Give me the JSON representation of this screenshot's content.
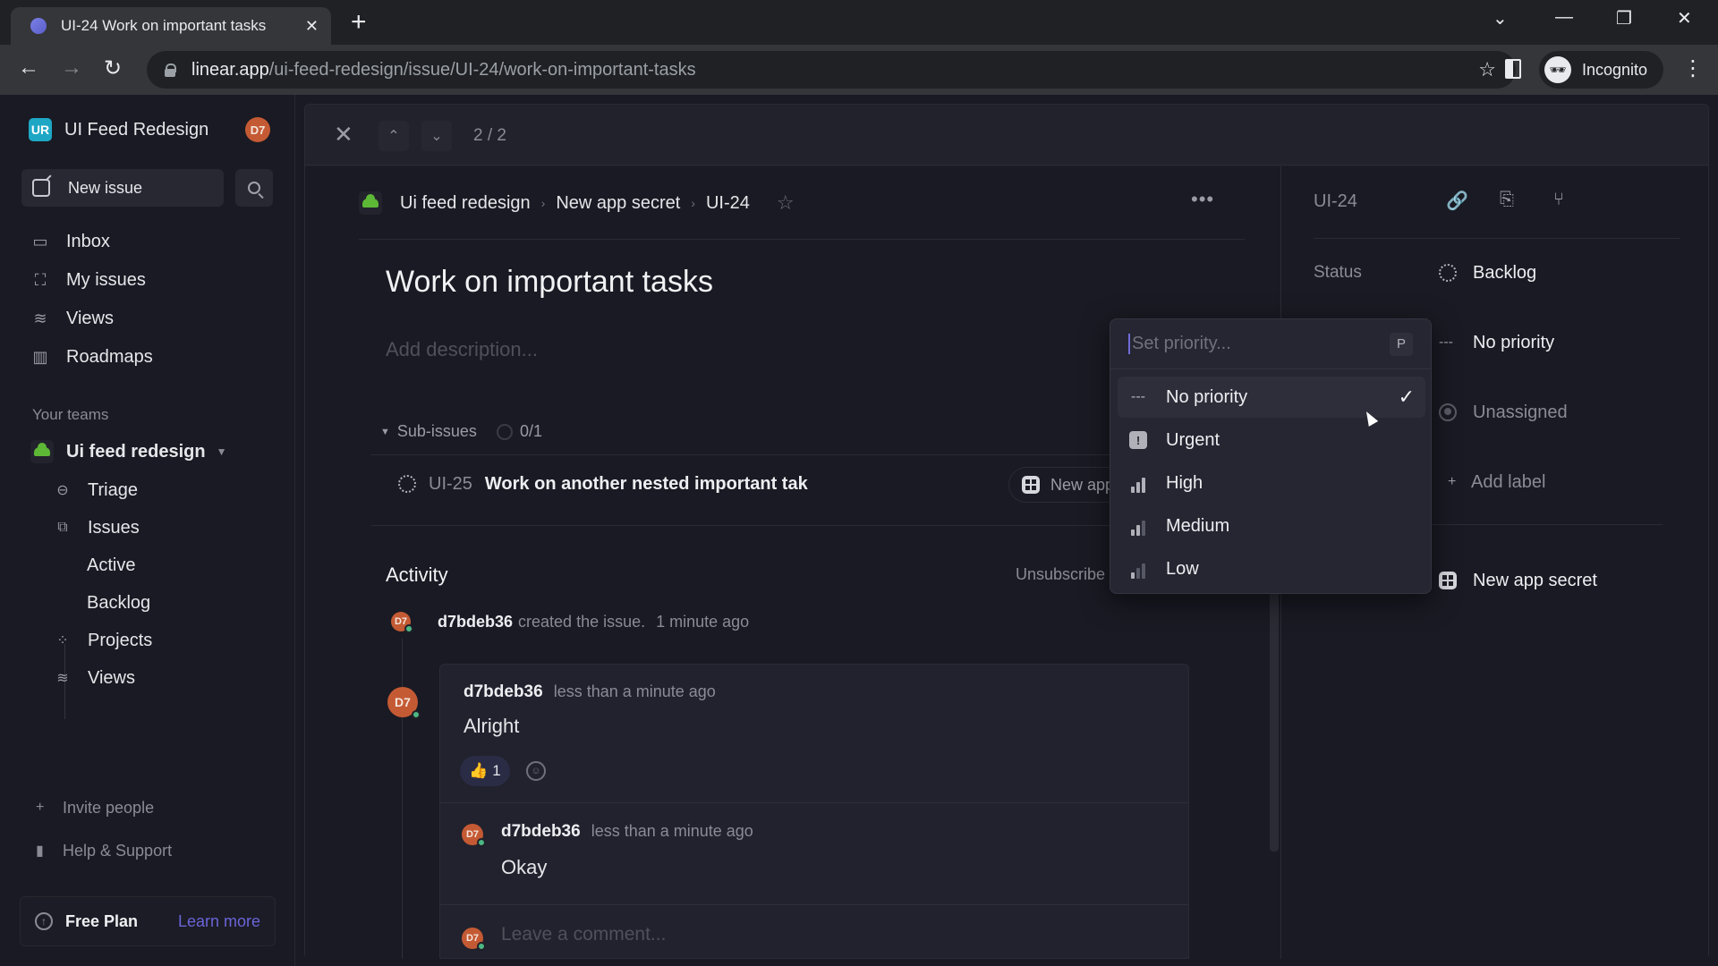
{
  "browser": {
    "tab_title": "UI-24 Work on important tasks",
    "url_host": "linear.app",
    "url_path": "/ui-feed-redesign/issue/UI-24/work-on-important-tasks",
    "profile_label": "Incognito"
  },
  "sidebar": {
    "workspace_logo": "UR",
    "workspace_name": "UI Feed Redesign",
    "user_avatar": "D7",
    "new_issue_label": "New issue",
    "nav": [
      {
        "label": "Inbox",
        "icon": "inbox-icon"
      },
      {
        "label": "My issues",
        "icon": "my-issues-icon"
      },
      {
        "label": "Views",
        "icon": "views-icon"
      },
      {
        "label": "Roadmaps",
        "icon": "roadmaps-icon"
      }
    ],
    "teams_label": "Your teams",
    "team_name": "Ui feed redesign",
    "team_items": [
      {
        "label": "Triage",
        "icon": "triage-icon"
      },
      {
        "label": "Issues",
        "icon": "issues-icon"
      },
      {
        "label": "Active"
      },
      {
        "label": "Backlog"
      },
      {
        "label": "Projects",
        "icon": "projects-icon"
      },
      {
        "label": "Views",
        "icon": "views-icon"
      }
    ],
    "invite_label": "Invite people",
    "help_label": "Help & Support",
    "plan_label": "Free Plan",
    "plan_link": "Learn more"
  },
  "issue_nav": {
    "pager": "2 / 2"
  },
  "issue": {
    "breadcrumb": [
      "Ui feed redesign",
      "New app secret",
      "UI-24"
    ],
    "title": "Work on important tasks",
    "description_placeholder": "Add description...",
    "subissues_label": "Sub-issues",
    "subissues_progress": "0/1",
    "subissues": [
      {
        "id": "UI-25",
        "title": "Work on another nested important tak",
        "project": "New app secret"
      }
    ],
    "activity_label": "Activity",
    "unsubscribe_label": "Unsubscribe",
    "events": [
      {
        "avatar": "D7",
        "user": "d7bdeb36",
        "text": "created the issue.",
        "time": "1 minute ago"
      }
    ],
    "comments": [
      {
        "avatar": "D7",
        "user": "d7bdeb36",
        "time": "less than a minute ago",
        "body": "Alright",
        "reaction": "👍",
        "reaction_count": "1"
      },
      {
        "avatar": "D7",
        "user": "d7bdeb36",
        "time": "less than a minute ago",
        "body": "Okay"
      }
    ],
    "comment_placeholder": "Leave a comment...",
    "comment_avatar": "D7"
  },
  "properties": {
    "issue_id": "UI-24",
    "status_label": "Status",
    "status_value": "Backlog",
    "priority_value": "No priority",
    "assignee_value": "Unassigned",
    "add_label": "Add label",
    "project_value": "New app secret"
  },
  "priority_menu": {
    "placeholder": "Set priority...",
    "shortcut": "P",
    "selected": "No priority",
    "options": [
      {
        "label": "No priority",
        "icon": "no-priority-icon"
      },
      {
        "label": "Urgent",
        "icon": "urgent-icon"
      },
      {
        "label": "High",
        "icon": "priority-high-icon"
      },
      {
        "label": "Medium",
        "icon": "priority-medium-icon"
      },
      {
        "label": "Low",
        "icon": "priority-low-icon"
      }
    ]
  },
  "colors": {
    "accent": "#6b64d8",
    "avatar": "#c45a34",
    "team_icon": "#5db836",
    "online": "#4cb782"
  }
}
